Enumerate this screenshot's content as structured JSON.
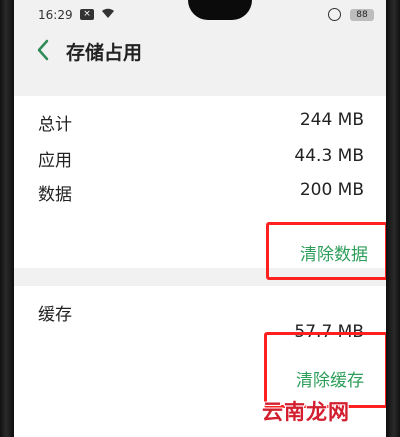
{
  "status_bar": {
    "time": "16:29",
    "x_badge": "×",
    "battery": "88",
    "icons": [
      "notification-x-icon",
      "wifi-icon",
      "alarm-icon",
      "battery-icon"
    ]
  },
  "header": {
    "back_icon": "chevron-left-icon",
    "title": "存储占用"
  },
  "storage": {
    "rows": [
      {
        "label": "总计",
        "value": "244 MB"
      },
      {
        "label": "应用",
        "value": "44.3 MB"
      },
      {
        "label": "数据",
        "value": "200 MB"
      }
    ],
    "clear_data_label": "清除数据"
  },
  "cache": {
    "label": "缓存",
    "value": "57.7 MB",
    "clear_cache_label": "清除缓存"
  },
  "watermark": "云南龙网",
  "colors": {
    "accent": "#2e9e5a",
    "highlight": "#ff2020",
    "watermark": "#d21e2e"
  }
}
